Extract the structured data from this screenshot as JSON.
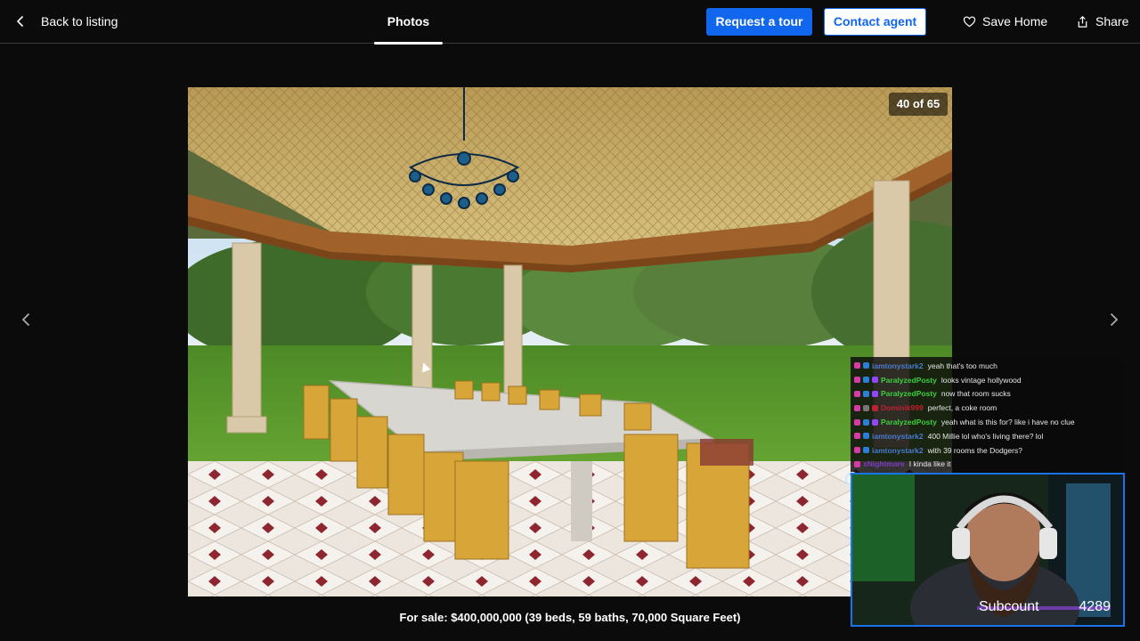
{
  "header": {
    "back_label": "Back to listing",
    "tab_label": "Photos",
    "request_tour_label": "Request a tour",
    "contact_agent_label": "Contact agent",
    "save_home_label": "Save Home",
    "share_label": "Share"
  },
  "gallery": {
    "counter": "40 of 65",
    "caption": "For sale: $400,000,000 (39 beds, 59 baths, 70,000 Square Feet)"
  },
  "chat": {
    "messages": [
      {
        "user": "iamtonystark2",
        "text": "yeah that's too much",
        "color": "#4a7bd0"
      },
      {
        "user": "ParalyzedPosty",
        "text": "looks vintage hollywood",
        "color": "#3ccf3c"
      },
      {
        "user": "ParalyzedPosty",
        "text": "now that room sucks",
        "color": "#3ccf3c"
      },
      {
        "user": "Dominik999",
        "text": "perfect, a coke room",
        "color": "#c02030"
      },
      {
        "user": "ParalyzedPosty",
        "text": "yeah what is this for? like i have no clue",
        "color": "#3ccf3c"
      },
      {
        "user": "iamtonystark2",
        "text": "400 Millie lol who's living there? lol",
        "color": "#4a7bd0"
      },
      {
        "user": "iamtonystark2",
        "text": "with 39 rooms the Dodgers?",
        "color": "#4a7bd0"
      },
      {
        "user": "xNightmare",
        "text": "I kinda like it",
        "color": "#7a3cc0"
      }
    ]
  },
  "webcam": {
    "subcount_label": "Subcount",
    "subcount_value": "4289"
  },
  "colors": {
    "accent": "#1166ee",
    "background": "#0b0b0b"
  }
}
